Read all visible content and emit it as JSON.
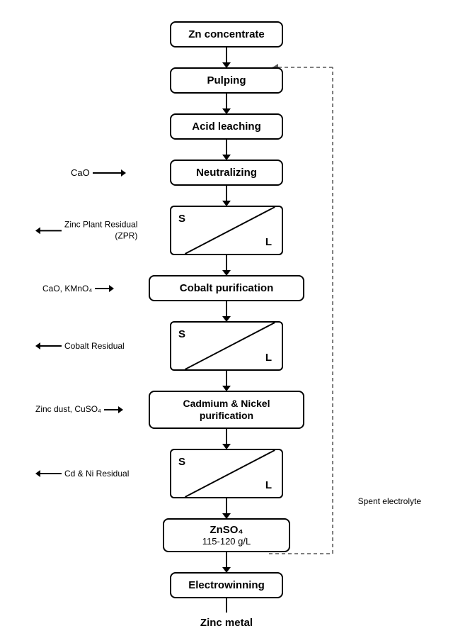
{
  "boxes": {
    "zn_concentrate": "Zn concentrate",
    "pulping": "Pulping",
    "acid_leaching": "Acid leaching",
    "neutralizing": "Neutralizing",
    "cobalt_purification": "Cobalt purification",
    "cadmium_nickel": "Cadmium & Nickel\npurification",
    "znso4": "ZnSO₄",
    "znso4_sub": "115-120 g/L",
    "electrowinning": "Electrowinning",
    "zinc_metal": "Zinc metal"
  },
  "side_labels": {
    "cao": "CaO",
    "zinc_plant_residual": "Zinc Plant Residual\n(ZPR)",
    "cao_kmno4": "CaO, KMnO₄",
    "cobalt_residual": "Cobalt Residual",
    "zinc_dust_cuso4": "Zinc dust,\nCuSO₄",
    "cd_ni_residual": "Cd & Ni Residual",
    "spent_electrolyte": "Spent\nelectrolyte"
  },
  "separator": {
    "s": "S",
    "l": "L"
  }
}
